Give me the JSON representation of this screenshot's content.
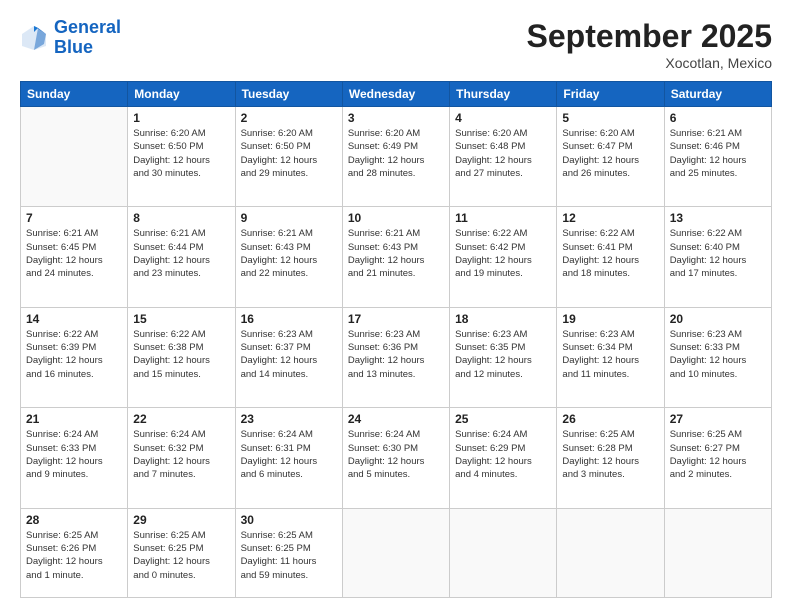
{
  "logo": {
    "line1": "General",
    "line2": "Blue"
  },
  "header": {
    "month": "September 2025",
    "location": "Xocotlan, Mexico"
  },
  "weekdays": [
    "Sunday",
    "Monday",
    "Tuesday",
    "Wednesday",
    "Thursday",
    "Friday",
    "Saturday"
  ],
  "weeks": [
    [
      {
        "day": "",
        "info": ""
      },
      {
        "day": "1",
        "info": "Sunrise: 6:20 AM\nSunset: 6:50 PM\nDaylight: 12 hours\nand 30 minutes."
      },
      {
        "day": "2",
        "info": "Sunrise: 6:20 AM\nSunset: 6:50 PM\nDaylight: 12 hours\nand 29 minutes."
      },
      {
        "day": "3",
        "info": "Sunrise: 6:20 AM\nSunset: 6:49 PM\nDaylight: 12 hours\nand 28 minutes."
      },
      {
        "day": "4",
        "info": "Sunrise: 6:20 AM\nSunset: 6:48 PM\nDaylight: 12 hours\nand 27 minutes."
      },
      {
        "day": "5",
        "info": "Sunrise: 6:20 AM\nSunset: 6:47 PM\nDaylight: 12 hours\nand 26 minutes."
      },
      {
        "day": "6",
        "info": "Sunrise: 6:21 AM\nSunset: 6:46 PM\nDaylight: 12 hours\nand 25 minutes."
      }
    ],
    [
      {
        "day": "7",
        "info": "Sunrise: 6:21 AM\nSunset: 6:45 PM\nDaylight: 12 hours\nand 24 minutes."
      },
      {
        "day": "8",
        "info": "Sunrise: 6:21 AM\nSunset: 6:44 PM\nDaylight: 12 hours\nand 23 minutes."
      },
      {
        "day": "9",
        "info": "Sunrise: 6:21 AM\nSunset: 6:43 PM\nDaylight: 12 hours\nand 22 minutes."
      },
      {
        "day": "10",
        "info": "Sunrise: 6:21 AM\nSunset: 6:43 PM\nDaylight: 12 hours\nand 21 minutes."
      },
      {
        "day": "11",
        "info": "Sunrise: 6:22 AM\nSunset: 6:42 PM\nDaylight: 12 hours\nand 19 minutes."
      },
      {
        "day": "12",
        "info": "Sunrise: 6:22 AM\nSunset: 6:41 PM\nDaylight: 12 hours\nand 18 minutes."
      },
      {
        "day": "13",
        "info": "Sunrise: 6:22 AM\nSunset: 6:40 PM\nDaylight: 12 hours\nand 17 minutes."
      }
    ],
    [
      {
        "day": "14",
        "info": "Sunrise: 6:22 AM\nSunset: 6:39 PM\nDaylight: 12 hours\nand 16 minutes."
      },
      {
        "day": "15",
        "info": "Sunrise: 6:22 AM\nSunset: 6:38 PM\nDaylight: 12 hours\nand 15 minutes."
      },
      {
        "day": "16",
        "info": "Sunrise: 6:23 AM\nSunset: 6:37 PM\nDaylight: 12 hours\nand 14 minutes."
      },
      {
        "day": "17",
        "info": "Sunrise: 6:23 AM\nSunset: 6:36 PM\nDaylight: 12 hours\nand 13 minutes."
      },
      {
        "day": "18",
        "info": "Sunrise: 6:23 AM\nSunset: 6:35 PM\nDaylight: 12 hours\nand 12 minutes."
      },
      {
        "day": "19",
        "info": "Sunrise: 6:23 AM\nSunset: 6:34 PM\nDaylight: 12 hours\nand 11 minutes."
      },
      {
        "day": "20",
        "info": "Sunrise: 6:23 AM\nSunset: 6:33 PM\nDaylight: 12 hours\nand 10 minutes."
      }
    ],
    [
      {
        "day": "21",
        "info": "Sunrise: 6:24 AM\nSunset: 6:33 PM\nDaylight: 12 hours\nand 9 minutes."
      },
      {
        "day": "22",
        "info": "Sunrise: 6:24 AM\nSunset: 6:32 PM\nDaylight: 12 hours\nand 7 minutes."
      },
      {
        "day": "23",
        "info": "Sunrise: 6:24 AM\nSunset: 6:31 PM\nDaylight: 12 hours\nand 6 minutes."
      },
      {
        "day": "24",
        "info": "Sunrise: 6:24 AM\nSunset: 6:30 PM\nDaylight: 12 hours\nand 5 minutes."
      },
      {
        "day": "25",
        "info": "Sunrise: 6:24 AM\nSunset: 6:29 PM\nDaylight: 12 hours\nand 4 minutes."
      },
      {
        "day": "26",
        "info": "Sunrise: 6:25 AM\nSunset: 6:28 PM\nDaylight: 12 hours\nand 3 minutes."
      },
      {
        "day": "27",
        "info": "Sunrise: 6:25 AM\nSunset: 6:27 PM\nDaylight: 12 hours\nand 2 minutes."
      }
    ],
    [
      {
        "day": "28",
        "info": "Sunrise: 6:25 AM\nSunset: 6:26 PM\nDaylight: 12 hours\nand 1 minute."
      },
      {
        "day": "29",
        "info": "Sunrise: 6:25 AM\nSunset: 6:25 PM\nDaylight: 12 hours\nand 0 minutes."
      },
      {
        "day": "30",
        "info": "Sunrise: 6:25 AM\nSunset: 6:25 PM\nDaylight: 11 hours\nand 59 minutes."
      },
      {
        "day": "",
        "info": ""
      },
      {
        "day": "",
        "info": ""
      },
      {
        "day": "",
        "info": ""
      },
      {
        "day": "",
        "info": ""
      }
    ]
  ]
}
